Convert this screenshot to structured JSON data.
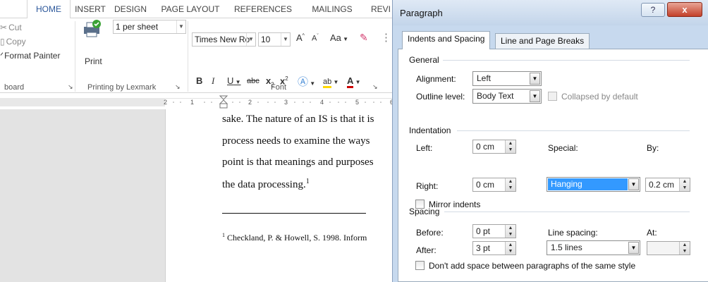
{
  "word": {
    "tabs": [
      "HOME",
      "INSERT",
      "DESIGN",
      "PAGE LAYOUT",
      "REFERENCES",
      "MAILINGS",
      "REVI"
    ],
    "clipboard": {
      "cut": "Cut",
      "copy": "Copy",
      "format_painter": "Format Painter",
      "group": "board"
    },
    "printing": {
      "pages_per_sheet": "1 per sheet",
      "print": "Print",
      "group": "Printing by Lexmark"
    },
    "font": {
      "name": "Times New Ro",
      "size": "10",
      "grow": "A",
      "shrink": "A",
      "case": "Aa",
      "bold": "B",
      "italic": "I",
      "underline": "U",
      "strike": "abc",
      "subscript": "x",
      "superscript": "x",
      "group": "Font"
    },
    "ruler": {
      "label_left": "2",
      "label_1": "1",
      "label_2": "2",
      "label_3": "3",
      "label_4": "4",
      "label_5": "5",
      "label_6": "6"
    },
    "document": {
      "lines": [
        "sake. The nature of an IS is that it is",
        "process needs to examine the ways",
        "point is that meanings and purposes",
        "the data processing."
      ],
      "footnote_mark": "1",
      "footnote": "Checkland, P. & Howell, S. 1998. Inform"
    }
  },
  "dialog": {
    "title": "Paragraph",
    "help": "?",
    "close": "x",
    "tabs": [
      "Indents and Spacing",
      "Line and Page Breaks"
    ],
    "general": {
      "heading": "General",
      "alignment_label": "Alignment:",
      "alignment_value": "Left",
      "outline_label": "Outline level:",
      "outline_value": "Body Text",
      "collapsed_label": "Collapsed by default"
    },
    "indentation": {
      "heading": "Indentation",
      "left_label": "Left:",
      "left_value": "0 cm",
      "right_label": "Right:",
      "right_value": "0 cm",
      "special_label": "Special:",
      "special_value": "Hanging",
      "by_label": "By:",
      "by_value": "0.2 cm",
      "mirror_label": "Mirror indents"
    },
    "spacing": {
      "heading": "Spacing",
      "before_label": "Before:",
      "before_value": "0 pt",
      "after_label": "After:",
      "after_value": "3 pt",
      "line_spacing_label": "Line spacing:",
      "line_spacing_value": "1.5 lines",
      "at_label": "At:",
      "at_value": "",
      "dont_add_label": "Don't add space between paragraphs of the same style"
    }
  }
}
